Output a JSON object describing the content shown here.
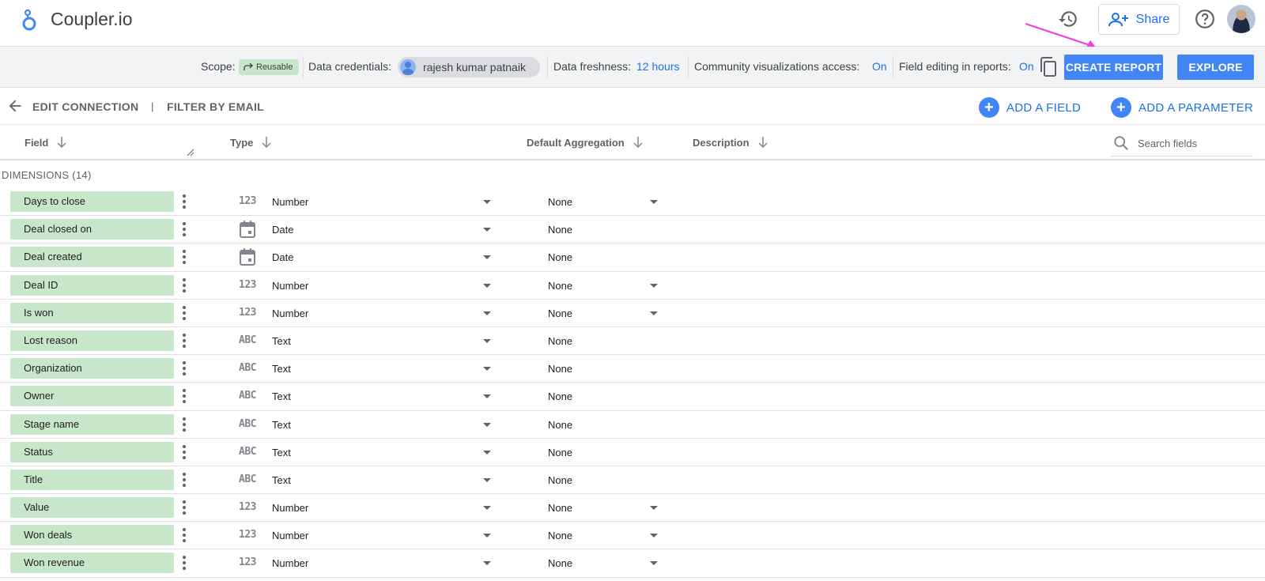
{
  "header": {
    "app_title": "Coupler.io",
    "share_label": "Share"
  },
  "scope_bar": {
    "scope_label": "Scope:",
    "scope_value": "Reusable",
    "credentials_label": "Data credentials:",
    "credentials_value": "rajesh kumar patnaik",
    "freshness_label": "Data freshness:",
    "freshness_value": "12 hours",
    "community_label": "Community visualizations access:",
    "community_value": "On",
    "field_editing_label": "Field editing in reports:",
    "field_editing_value": "On",
    "create_report_label": "CREATE REPORT",
    "explore_label": "EXPLORE"
  },
  "breadcrumb": {
    "edit_connection": "EDIT CONNECTION",
    "separator": "|",
    "filter_by_email": "FILTER BY EMAIL",
    "add_field": "ADD A FIELD",
    "add_parameter": "ADD A PARAMETER"
  },
  "columns": {
    "field": "Field",
    "type": "Type",
    "default_aggregation": "Default Aggregation",
    "description": "Description",
    "search_placeholder": "Search fields"
  },
  "section": {
    "label": "DIMENSIONS (14)"
  },
  "type_icons": {
    "number": "123",
    "text": "ABC"
  },
  "rows": [
    {
      "field": "Days to close",
      "type": "Number",
      "type_icon": "number",
      "aggregation": "None",
      "agg_dropdown": true
    },
    {
      "field": "Deal closed on",
      "type": "Date",
      "type_icon": "calendar-icon",
      "aggregation": "None",
      "agg_dropdown": false
    },
    {
      "field": "Deal created",
      "type": "Date",
      "type_icon": "calendar-icon",
      "aggregation": "None",
      "agg_dropdown": false
    },
    {
      "field": "Deal ID",
      "type": "Number",
      "type_icon": "number",
      "aggregation": "None",
      "agg_dropdown": true
    },
    {
      "field": "Is won",
      "type": "Number",
      "type_icon": "number",
      "aggregation": "None",
      "agg_dropdown": true
    },
    {
      "field": "Lost reason",
      "type": "Text",
      "type_icon": "text",
      "aggregation": "None",
      "agg_dropdown": false
    },
    {
      "field": "Organization",
      "type": "Text",
      "type_icon": "text",
      "aggregation": "None",
      "agg_dropdown": false
    },
    {
      "field": "Owner",
      "type": "Text",
      "type_icon": "text",
      "aggregation": "None",
      "agg_dropdown": false
    },
    {
      "field": "Stage name",
      "type": "Text",
      "type_icon": "text",
      "aggregation": "None",
      "agg_dropdown": false
    },
    {
      "field": "Status",
      "type": "Text",
      "type_icon": "text",
      "aggregation": "None",
      "agg_dropdown": false
    },
    {
      "field": "Title",
      "type": "Text",
      "type_icon": "text",
      "aggregation": "None",
      "agg_dropdown": false
    },
    {
      "field": "Value",
      "type": "Number",
      "type_icon": "number",
      "aggregation": "None",
      "agg_dropdown": true
    },
    {
      "field": "Won deals",
      "type": "Number",
      "type_icon": "number",
      "aggregation": "None",
      "agg_dropdown": true
    },
    {
      "field": "Won revenue",
      "type": "Number",
      "type_icon": "number",
      "aggregation": "None",
      "agg_dropdown": true
    }
  ],
  "colors": {
    "accent": "#4285f4",
    "link": "#1a73e8",
    "field_chip": "#c8e6c9",
    "annotation_arrow": "#f03ce6"
  }
}
